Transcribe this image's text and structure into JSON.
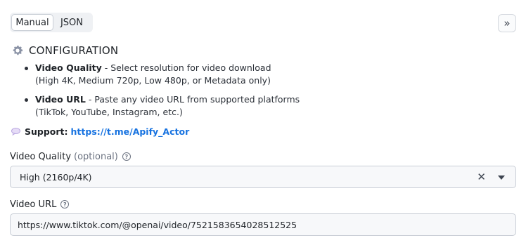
{
  "tabs": {
    "manual": "Manual",
    "json": "JSON"
  },
  "expand_icon_glyph": "»",
  "configuration": {
    "title": "CONFIGURATION",
    "icon": "gear-icon",
    "items": [
      {
        "name": "Video Quality",
        "sep": " - ",
        "desc": "Select resolution for video download",
        "sub": "(High 4K, Medium 720p, Low 480p, or Metadata only)"
      },
      {
        "name": "Video URL",
        "sep": " - ",
        "desc": "Paste any video URL from supported platforms",
        "sub": "(TikTok, YouTube, Instagram, etc.)"
      }
    ],
    "support_label": "Support:",
    "support_link": "https://t.me/Apify_Actor"
  },
  "fields": {
    "quality": {
      "label": "Video Quality",
      "optional": "(optional)",
      "value": "High (2160p/4K)",
      "help_glyph": "?"
    },
    "url": {
      "label": "Video URL",
      "value": "https://www.tiktok.com/@openai/video/7521583654028512525",
      "help_glyph": "?"
    }
  },
  "colors": {
    "link": "#1672e0",
    "gear": "#8b93a6",
    "chat": "#b8a6e0"
  }
}
